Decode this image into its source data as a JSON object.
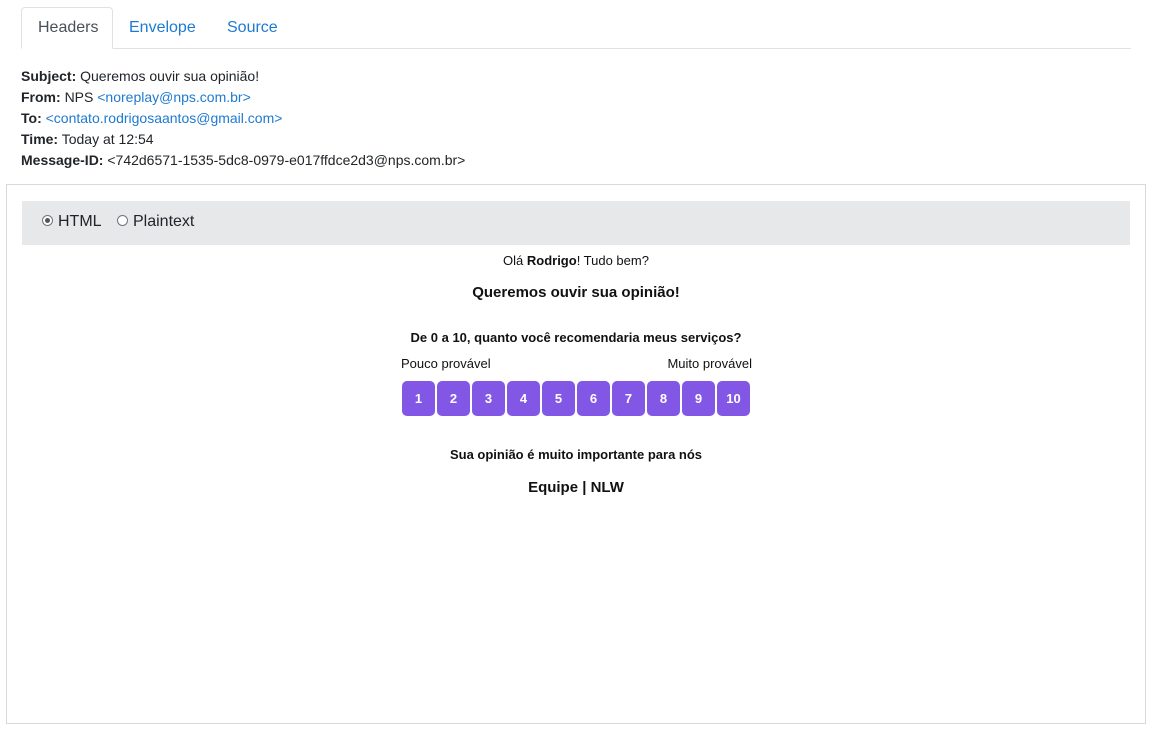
{
  "tabs": [
    {
      "label": "Headers",
      "active": true
    },
    {
      "label": "Envelope",
      "active": false
    },
    {
      "label": "Source",
      "active": false
    }
  ],
  "headers": {
    "subject_label": "Subject:",
    "subject": "Queremos ouvir sua opinião!",
    "from_label": "From:",
    "from_name": "NPS",
    "from_email": "<noreplay@nps.com.br>",
    "to_label": "To:",
    "to_email": "<contato.rodrigosaantos@gmail.com>",
    "time_label": "Time:",
    "time": "Today at 12:54",
    "message_id_label": "Message-ID:",
    "message_id": "<742d6571-1535-5dc8-0979-e017ffdce2d3@nps.com.br>"
  },
  "format": {
    "options": [
      {
        "label": "HTML",
        "checked": true
      },
      {
        "label": "Plaintext",
        "checked": false
      }
    ]
  },
  "email": {
    "greeting_prefix": "Olá ",
    "greeting_name": "Rodrigo",
    "greeting_suffix": "! Tudo bem?",
    "headline": "Queremos ouvir sua opinião!",
    "question": "De 0 a 10, quanto você recomendaria meus serviços?",
    "low_label": "Pouco provável",
    "high_label": "Muito provável",
    "scores": [
      "1",
      "2",
      "3",
      "4",
      "5",
      "6",
      "7",
      "8",
      "9",
      "10"
    ],
    "note": "Sua opinião é muito importante para nós",
    "signature": "Equipe | NLW"
  },
  "colors": {
    "link": "#1e7ad0",
    "score_button": "#8257e5",
    "format_bar": "#e7e8ea"
  }
}
